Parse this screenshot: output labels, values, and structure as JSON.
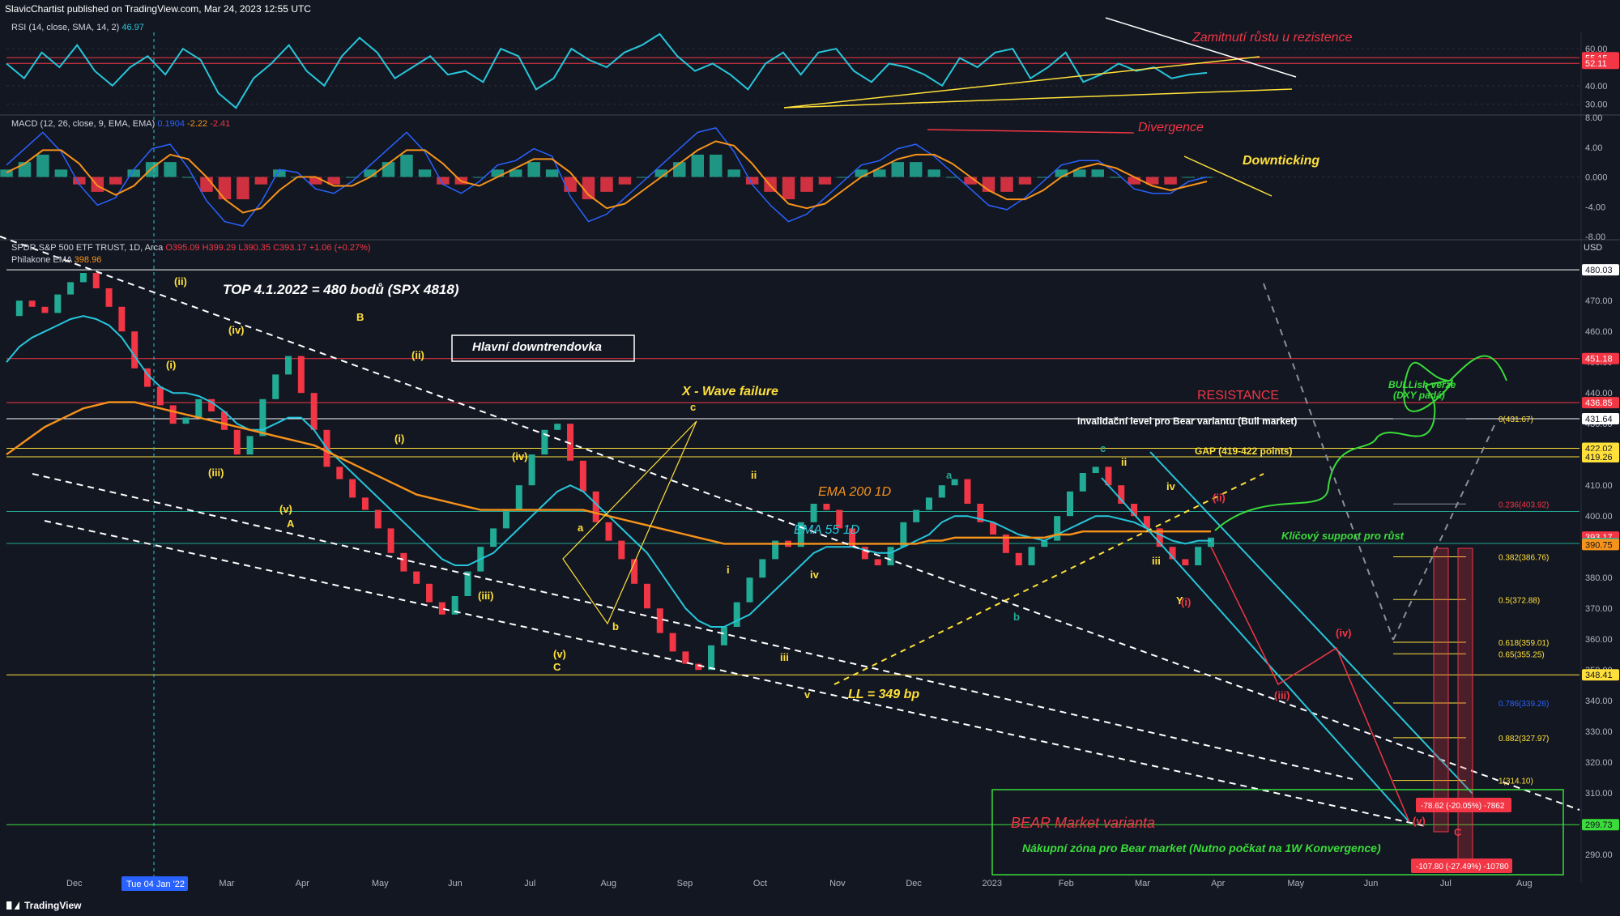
{
  "header": {
    "published": "SlavicChartist published on TradingView.com, Mar 24, 2023 12:55 UTC"
  },
  "footer": {
    "brand": "TradingView"
  },
  "colors": {
    "background": "#131722",
    "grid": "#1e222d",
    "cyan": "#26c6da",
    "orange": "#f7931a",
    "yellow": "#ffe03a",
    "red": "#f23645",
    "green": "#22ab94",
    "white": "#ffffff",
    "lime": "#3adb3a",
    "macd_line": "#2962ff"
  },
  "chart_data": [
    {
      "type": "line",
      "pane": "RSI",
      "title": "RSI (14, close, SMA, 14, 2)",
      "value_label": "46.97",
      "ylim": [
        25,
        68
      ],
      "yticks": [
        "60.00",
        "40.00",
        "30.00"
      ],
      "price_tags": [
        {
          "label": "55.15",
          "value": 55.15,
          "color": "#f23645"
        },
        {
          "label": "52.11",
          "value": 52.11,
          "color": "#f23645"
        }
      ],
      "levels": [
        55.15,
        52.11
      ],
      "series": [
        {
          "values": [
            52,
            44,
            58,
            50,
            62,
            48,
            40,
            50,
            56,
            46,
            60,
            54,
            36,
            28,
            44,
            52,
            62,
            48,
            40,
            56,
            66,
            58,
            44,
            50,
            56,
            46,
            48,
            42,
            60,
            56,
            38,
            44,
            60,
            54,
            50,
            58,
            62,
            68,
            56,
            48,
            52,
            46,
            38,
            52,
            58,
            46,
            58,
            60,
            48,
            42,
            52,
            50,
            46,
            40,
            55,
            50,
            58,
            60,
            44,
            50,
            58,
            42,
            46,
            52,
            48,
            50,
            44,
            46,
            47
          ]
        }
      ],
      "annotations": [
        {
          "text": "Zamitnutí růstu u rezistence",
          "color": "#f23645"
        }
      ]
    },
    {
      "type": "bar",
      "pane": "MACD",
      "title": "MACD (12, 26, close, 9, EMA, EMA)",
      "value_labels": [
        "0.1904",
        "-2.22",
        "-2.41"
      ],
      "ylim": [
        -8,
        8
      ],
      "yticks": [
        "8.00",
        "4.00",
        "0.000",
        "-4.00",
        "-8.00"
      ],
      "series": [
        {
          "values": [
            1,
            2,
            3,
            1,
            -1,
            -2,
            -1,
            1,
            2,
            2,
            0,
            -2,
            -3,
            -3,
            -1,
            1,
            0,
            -1,
            -1,
            0,
            1,
            2,
            3,
            1,
            -1,
            -1,
            0,
            1,
            1,
            2,
            1,
            -2,
            -3,
            -2,
            -1,
            0,
            1,
            2,
            3,
            3,
            1,
            -1,
            -2,
            -3,
            -2,
            -1,
            0,
            1,
            1,
            2,
            2,
            1,
            0,
            -1,
            -2,
            -2,
            -1,
            0,
            1,
            1,
            1,
            0,
            -1,
            -1,
            -1,
            0,
            0
          ]
        }
      ],
      "annotations": [
        {
          "text": "Divergence",
          "color": "#f23645"
        },
        {
          "text": "Downticking",
          "color": "#ffe03a"
        }
      ]
    },
    {
      "type": "line",
      "pane": "Price",
      "title": "SPDR S&P 500 ETF TRUST, 1D, Arca",
      "ohlc_label": "O395.09 H399.29 L390.35 C393.17 +1.06 (+0.27%)",
      "sub_title": "Philakone EMA",
      "sub_values": [
        "398.96"
      ],
      "currency": "USD",
      "ylim": [
        284,
        484
      ],
      "yticks": [
        "470.00",
        "460.00",
        "450.00",
        "440.00",
        "430.00",
        "420.00",
        "410.00",
        "400.00",
        "390.00",
        "380.00",
        "370.00",
        "360.00",
        "350.00",
        "340.00",
        "330.00",
        "320.00",
        "310.00",
        "300.00",
        "290.00"
      ],
      "x_ticks": [
        "Dec",
        "Feb",
        "Mar",
        "Apr",
        "May",
        "Jun",
        "Jul",
        "Aug",
        "Sep",
        "Oct",
        "Nov",
        "Dec",
        "2023",
        "Feb",
        "Mar",
        "Apr",
        "May",
        "Jun",
        "Jul",
        "Aug"
      ],
      "x_highlight": "Tue 04 Jan '22",
      "series": [
        {
          "name": "Price",
          "values": [
            465,
            470,
            468,
            466,
            472,
            476,
            479,
            474,
            468,
            460,
            448,
            442,
            436,
            430,
            432,
            438,
            434,
            428,
            420,
            426,
            438,
            446,
            452,
            440,
            428,
            416,
            412,
            406,
            402,
            396,
            388,
            382,
            378,
            372,
            368,
            374,
            382,
            390,
            396,
            402,
            410,
            420,
            428,
            430,
            418,
            408,
            398,
            392,
            386,
            378,
            370,
            362,
            356,
            352,
            350,
            358,
            364,
            372,
            380,
            386,
            392,
            390,
            398,
            404,
            402,
            396,
            390,
            386,
            384,
            390,
            398,
            402,
            406,
            410,
            412,
            404,
            398,
            394,
            388,
            384,
            390,
            392,
            400,
            408,
            414,
            416,
            410,
            404,
            400,
            396,
            390,
            386,
            384,
            390,
            393
          ]
        },
        {
          "name": "EMA 55 1D",
          "values": [
            450,
            455,
            458,
            460,
            462,
            464,
            465,
            464,
            462,
            458,
            452,
            446,
            442,
            440,
            440,
            439,
            437,
            434,
            430,
            428,
            428,
            430,
            432,
            432,
            428,
            422,
            418,
            414,
            410,
            406,
            402,
            398,
            394,
            390,
            386,
            384,
            384,
            386,
            388,
            392,
            396,
            400,
            404,
            408,
            410,
            408,
            404,
            400,
            396,
            392,
            388,
            382,
            376,
            370,
            366,
            364,
            364,
            366,
            368,
            372,
            376,
            380,
            384,
            388,
            390,
            390,
            390,
            389,
            388,
            388,
            390,
            392,
            394,
            398,
            400,
            400,
            399,
            398,
            396,
            394,
            393,
            392,
            394,
            396,
            398,
            400,
            400,
            399,
            398,
            396,
            394,
            392,
            391,
            392,
            392
          ]
        },
        {
          "name": "EMA 200 1D",
          "values": [
            420,
            423,
            426,
            429,
            431,
            433,
            435,
            436,
            437,
            437,
            437,
            436,
            435,
            434,
            433,
            432,
            431,
            430,
            429,
            428,
            427,
            426,
            425,
            424,
            423,
            421,
            419,
            417,
            415,
            413,
            411,
            409,
            407,
            406,
            405,
            404,
            403,
            402,
            402,
            402,
            402,
            402,
            402,
            402,
            402,
            402,
            401,
            400,
            399,
            398,
            397,
            396,
            395,
            394,
            393,
            392,
            391,
            391,
            391,
            391,
            391,
            391,
            391,
            391,
            391,
            391,
            391,
            391,
            391,
            391,
            391,
            391,
            392,
            392,
            393,
            393,
            393,
            393,
            393,
            393,
            393,
            393,
            394,
            394,
            395,
            395,
            395,
            395,
            395,
            395,
            395,
            395,
            395,
            395,
            395
          ]
        }
      ],
      "price_tags": [
        {
          "label": "480.03",
          "value": 480.03,
          "color": "#ffffff"
        },
        {
          "label": "451.18",
          "value": 451.18,
          "color": "#f23645"
        },
        {
          "label": "436.85",
          "value": 436.85,
          "color": "#f23645"
        },
        {
          "label": "431.64",
          "value": 431.64,
          "color": "#ffffff"
        },
        {
          "label": "422.02",
          "value": 422.02,
          "color": "#ffe03a"
        },
        {
          "label": "419.26",
          "value": 419.26,
          "color": "#ffe03a"
        },
        {
          "label": "393.17",
          "value": 393.17,
          "color": "#f23645"
        },
        {
          "label": "391.11",
          "value": 391.11,
          "color": "#22ab94"
        },
        {
          "label": "390.75",
          "value": 390.75,
          "color": "#f7931a"
        },
        {
          "label": "348.41",
          "value": 348.41,
          "color": "#ffe03a"
        },
        {
          "label": "299.73",
          "value": 299.73,
          "color": "#3adb3a"
        }
      ],
      "levels": [
        {
          "value": 480.03,
          "color": "#ffffff"
        },
        {
          "value": 451.18,
          "color": "#f23645"
        },
        {
          "value": 436.85,
          "color": "#f23645"
        },
        {
          "value": 431.64,
          "color": "#ffffff"
        },
        {
          "value": 422.02,
          "color": "#ffe03a"
        },
        {
          "value": 419.26,
          "color": "#ffe03a"
        },
        {
          "value": 401.5,
          "color": "#22ab94"
        },
        {
          "value": 391.11,
          "color": "#22ab94"
        },
        {
          "value": 348.41,
          "color": "#ffe03a"
        },
        {
          "value": 299.73,
          "color": "#3adb3a"
        }
      ],
      "fib_levels": [
        {
          "label": "0(431.67)",
          "value": 431.67
        },
        {
          "label": "0.236(403.92)",
          "value": 403.92
        },
        {
          "label": "0.382(386.76)",
          "value": 386.76
        },
        {
          "label": "0.5(372.88)",
          "value": 372.88
        },
        {
          "label": "0.618(359.01)",
          "value": 359.01
        },
        {
          "label": "0.65(355.25)",
          "value": 355.25
        },
        {
          "label": "0.786(339.26)",
          "value": 339.26
        },
        {
          "label": "0.882(327.97)",
          "value": 327.97
        },
        {
          "label": "1(314.10)",
          "value": 314.1
        }
      ],
      "measure_labels": [
        {
          "text": "-78.62 (-20.05%) -7862"
        },
        {
          "text": "-107.80 (-27.49%) -10780"
        }
      ],
      "annotations": [
        {
          "text": "TOP 4.1.2022 = 480 bodů (SPX 4818)",
          "color": "#ffffff"
        },
        {
          "text": "Hlavní downtrendovka",
          "color": "#ffffff"
        },
        {
          "text": "X - Wave failure",
          "color": "#ffe03a"
        },
        {
          "text": "RESISTANCE",
          "color": "#f23645"
        },
        {
          "text": "Invalidační level pro Bear variantu (Bull market)",
          "color": "#ffffff"
        },
        {
          "text": "GAP (419-422 points)",
          "color": "#ffe03a"
        },
        {
          "text": "EMA 200 1D",
          "color": "#f7931a"
        },
        {
          "text": "EMA 55 1D",
          "color": "#26c6da"
        },
        {
          "text": "Klíčový support pro růst",
          "color": "#3adb3a"
        },
        {
          "text": "BULLish verze",
          "color": "#3adb3a"
        },
        {
          "text": "(DXY padá)",
          "color": "#3adb3a"
        },
        {
          "text": "LL = 349 bp",
          "color": "#ffe03a"
        },
        {
          "text": "BEAR Market varianta",
          "color": "#f23645"
        },
        {
          "text": "Nákupní zóna pro Bear market (Nutno počkat na 1W Konvergence)",
          "color": "#3adb3a"
        }
      ],
      "wave_labels": [
        "(ii)",
        "(i)",
        "(iv)",
        "(iii)",
        "(v)",
        "A",
        "B",
        "(ii)",
        "(i)",
        "(iv)",
        "(iii)",
        "(v)",
        "C",
        "a",
        "b",
        "c",
        "ii",
        "i",
        "iv",
        "iii",
        "v",
        "a",
        "b",
        "c",
        "ii",
        "iv",
        "iii",
        "(ii)",
        "Y",
        "(i)",
        "(iv)",
        "(iii)",
        "(v)",
        "C"
      ]
    }
  ]
}
